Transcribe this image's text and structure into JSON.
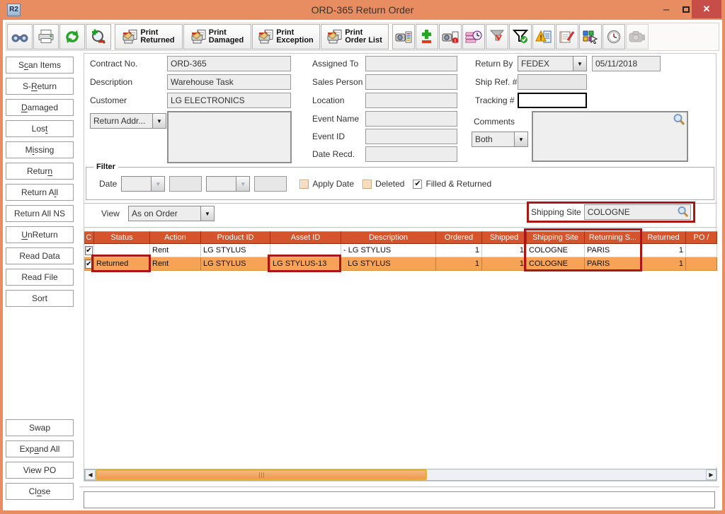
{
  "window": {
    "title": "ORD-365 Return Order",
    "app_badge": "R2"
  },
  "titlebar": {
    "minimize": "–",
    "maximize": "maximize",
    "close": "✕"
  },
  "toolbar": {
    "icon_buttons_left": [
      {
        "name": "binoculars-icon"
      },
      {
        "name": "printer-icon"
      },
      {
        "name": "refresh-icon"
      },
      {
        "name": "zoom-plus-minus-icon"
      }
    ],
    "print_buttons": [
      {
        "label1": "Print",
        "label2": "Returned"
      },
      {
        "label1": "Print",
        "label2": "Damaged"
      },
      {
        "label1": "Print",
        "label2": "Exception"
      },
      {
        "label1": "Print",
        "label2": "Order List"
      }
    ],
    "icon_buttons_right": [
      {
        "name": "equipment-list-icon",
        "disabled": false
      },
      {
        "name": "add-remove-icon",
        "disabled": false
      },
      {
        "name": "equipment-alert-icon",
        "disabled": false
      },
      {
        "name": "notes-clock-icon",
        "disabled": false
      },
      {
        "name": "filter-down-icon",
        "disabled": false
      },
      {
        "name": "filter-check-icon",
        "disabled": false
      },
      {
        "name": "alert-document-icon",
        "disabled": false
      },
      {
        "name": "notepad-edit-icon",
        "disabled": false
      },
      {
        "name": "color-grid-cursor-icon",
        "disabled": false
      },
      {
        "name": "clock-icon",
        "disabled": false
      },
      {
        "name": "camera-disabled-icon",
        "disabled": true
      }
    ]
  },
  "sidebar": {
    "top_buttons": [
      {
        "label": "Scan Items",
        "mnemonic_index": 1
      },
      {
        "label": "S-Return",
        "mnemonic_index": 2
      },
      {
        "label": "Damaged",
        "mnemonic_index": 0
      },
      {
        "label": "Lost",
        "mnemonic_index": 3
      },
      {
        "label": "Missing",
        "mnemonic_index": 1
      },
      {
        "label": "Return",
        "mnemonic_index": 5
      },
      {
        "label": "Return All",
        "mnemonic_index": 8
      },
      {
        "label": "Return All NS",
        "mnemonic_index": -1
      },
      {
        "label": "UnReturn",
        "mnemonic_index": 0
      },
      {
        "label": "Read Data",
        "mnemonic_index": -1
      },
      {
        "label": "Read File",
        "mnemonic_index": -1
      },
      {
        "label": "Sort",
        "mnemonic_index": -1
      }
    ],
    "bottom_buttons": [
      {
        "label": "Swap",
        "mnemonic_index": -1
      },
      {
        "label": "Expand All",
        "mnemonic_index": 3
      },
      {
        "label": "View PO",
        "mnemonic_index": -1
      },
      {
        "label": "Close",
        "mnemonic_index": 2
      }
    ]
  },
  "form": {
    "left": {
      "contract_label": "Contract No.",
      "contract_value": "ORD-365",
      "description_label": "Description",
      "description_value": "Warehouse Task",
      "customer_label": "Customer",
      "customer_value": "LG ELECTRONICS",
      "return_addr_label": "Return Addr...",
      "address_value": ""
    },
    "middle": {
      "assigned_label": "Assigned To",
      "assigned_value": "",
      "sales_label": "Sales Person",
      "sales_value": "",
      "location_label": "Location",
      "location_value": "",
      "event_name_label": "Event Name",
      "event_name_value": "",
      "event_id_label": "Event ID",
      "event_id_value": "",
      "date_recd_label": "Date Recd.",
      "date_recd_value": ""
    },
    "right": {
      "return_by_label": "Return By",
      "return_by_value": "FEDEX",
      "return_date": "05/11/2018",
      "ship_ref_label": "Ship Ref. #",
      "ship_ref_value": "",
      "tracking_label": "Tracking #",
      "tracking_value": "",
      "comments_label": "Comments",
      "comments_type": "Both",
      "comments_value": ""
    }
  },
  "filter": {
    "title": "Filter",
    "date_label": "Date",
    "date_fields": [
      "",
      "",
      "",
      ""
    ],
    "checkboxes": [
      {
        "label": "Apply Date",
        "checked": false,
        "disabled": true
      },
      {
        "label": "Deleted",
        "checked": false,
        "disabled": true
      },
      {
        "label": "Filled & Returned",
        "checked": true,
        "disabled": false
      }
    ]
  },
  "view": {
    "label": "View",
    "value": "As on Order",
    "shipping_site_label": "Shipping Site",
    "shipping_site_value": "COLOGNE"
  },
  "table": {
    "columns": [
      {
        "label": "C",
        "width": 14,
        "align": "center"
      },
      {
        "label": "Status",
        "width": 79,
        "align": "left"
      },
      {
        "label": "Action",
        "width": 72,
        "align": "left"
      },
      {
        "label": "Product ID",
        "width": 98,
        "align": "left"
      },
      {
        "label": "Asset ID",
        "width": 100,
        "align": "left"
      },
      {
        "label": "Description",
        "width": 134,
        "align": "left"
      },
      {
        "label": "Ordered",
        "width": 65,
        "align": "right"
      },
      {
        "label": "Shipped",
        "width": 63,
        "align": "right"
      },
      {
        "label": "Shipping Site",
        "width": 82,
        "align": "left"
      },
      {
        "label": "Returning S...",
        "width": 80,
        "align": "left"
      },
      {
        "label": "Returned",
        "width": 63,
        "align": "right"
      },
      {
        "label": "PO /",
        "width": 44,
        "align": "left"
      }
    ],
    "rows": [
      {
        "selected": false,
        "checked": true,
        "cells": [
          "",
          "",
          "Rent",
          "LG STYLUS",
          "",
          "- LG STYLUS",
          "1",
          "1",
          "COLOGNE",
          "PARIS",
          "1",
          ""
        ]
      },
      {
        "selected": true,
        "checked": true,
        "cells": [
          "",
          "Returned",
          "Rent",
          "LG STYLUS",
          "LG STYLUS-13",
          "  LG STYLUS",
          "1",
          "1",
          "COLOGNE",
          "PARIS",
          "1",
          ""
        ]
      }
    ]
  },
  "annotations": {
    "highlights": [
      "shipping-site-field",
      "row2-status-cell",
      "row2-asset-cell",
      "shipping-and-returning-columns"
    ]
  },
  "scrollbar": {
    "left_arrow": "◀",
    "right_arrow": "▶"
  },
  "bottom_note": {
    "value": ""
  },
  "colors": {
    "titlebar": "#E88C62",
    "table_header": "#D5542C",
    "selected_row": "#F6A358",
    "close_button": "#C74D49",
    "highlight_box": "#AA1515",
    "scroll_thumb": "#EE9A4E"
  }
}
